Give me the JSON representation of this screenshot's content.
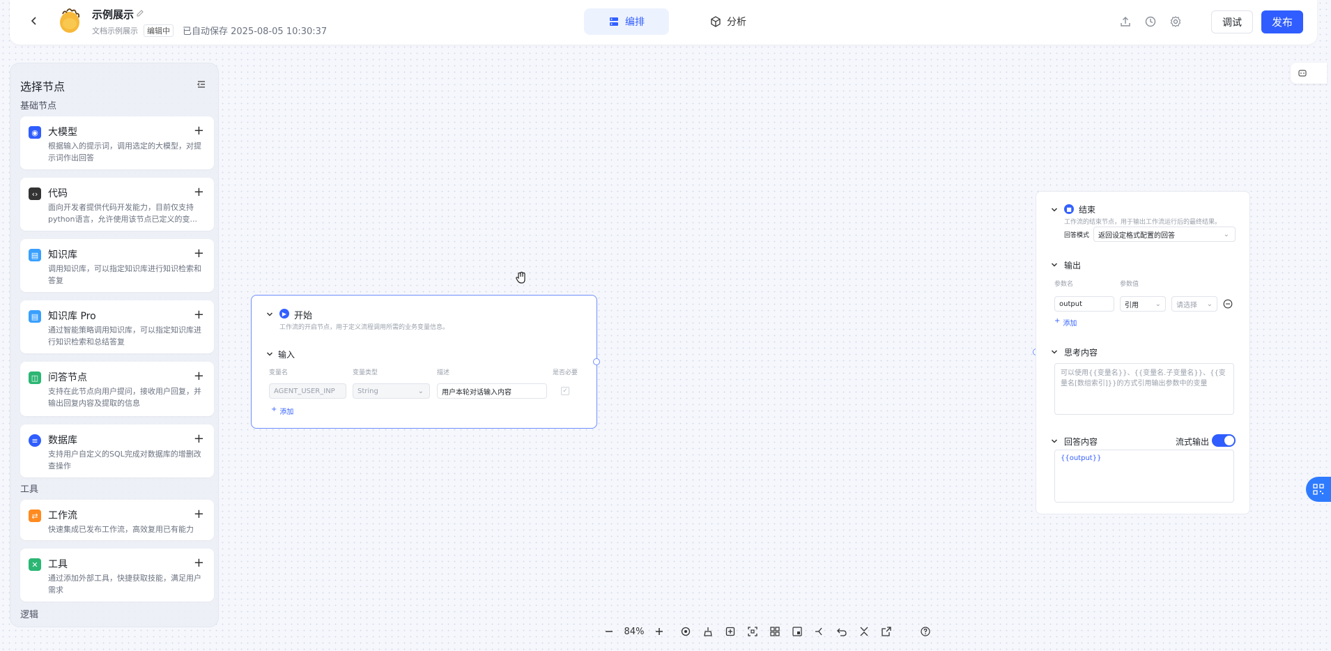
{
  "header": {
    "app_name": "示例展示",
    "app_type": "文档示例展示",
    "status_badge": "编辑中",
    "autosave": "已自动保存 2025-08-05 10:30:37",
    "tabs": {
      "orchestrate": "编排",
      "analyze": "分析"
    },
    "debug_label": "调试",
    "publish_label": "发布"
  },
  "sidebar": {
    "title": "选择节点",
    "section_basic": "基础节点",
    "section_tools": "工具",
    "section_logic": "逻辑",
    "nodes": [
      {
        "name": "大模型",
        "desc": "根据输入的提示词，调用选定的大模型，对提示词作出回答",
        "color": "#2f5dff"
      },
      {
        "name": "代码",
        "desc": "面向开发者提供代码开发能力，目前仅支持python语言，允许使用该节点已定义的变...",
        "color": "#333333"
      },
      {
        "name": "知识库",
        "desc": "调用知识库，可以指定知识库进行知识检索和答复",
        "color": "#3aa0ff"
      },
      {
        "name": "知识库 Pro",
        "desc": "通过智能策略调用知识库，可以指定知识库进行知识检索和总结答复",
        "color": "#3aa0ff"
      },
      {
        "name": "问答节点",
        "desc": "支持在此节点向用户提问，接收用户回复，并输出回复内容及提取的信息",
        "color": "#2bb673"
      },
      {
        "name": "数据库",
        "desc": "支持用户自定义的SQL完成对数据库的增删改查操作",
        "color": "#2f5dff"
      },
      {
        "name": "工作流",
        "desc": "快速集成已发布工作流，高效复用已有能力",
        "color": "#ff8a1f"
      },
      {
        "name": "工具",
        "desc": "通过添加外部工具，快捷获取技能，满足用户需求",
        "color": "#2bb673"
      }
    ]
  },
  "start_node": {
    "title": "开始",
    "subtitle": "工作流的开启节点，用于定义流程调用所需的业务变量信息。",
    "input_section": "输入",
    "col_var": "变量名",
    "col_type": "变量类型",
    "col_desc": "描述",
    "col_required": "是否必要",
    "row_var": "AGENT_USER_INP",
    "row_type": "String",
    "row_desc": "用户本轮对话输入内容",
    "add_label": "添加"
  },
  "end_node": {
    "title": "结束",
    "subtitle": "工作流的结束节点，用于输出工作流运行后的最终结果。",
    "mode_label": "回答模式",
    "mode_value": "返回设定格式配置的回答",
    "output_section": "输出",
    "col_param": "参数名",
    "col_value": "参数值",
    "param_name": "output",
    "param_ref": "引用",
    "param_placeholder": "请选择",
    "add_label": "添加",
    "thinking_section": "思考内容",
    "thinking_placeholder": "可以使用{{变量名}}、{{变量名.子变量名}}、{{变量名[数组索引]}}的方式引用输出参数中的变量",
    "answer_section": "回答内容",
    "stream_label": "流式输出",
    "answer_value": "{{output}}"
  },
  "toolbar": {
    "zoom": "84%"
  }
}
